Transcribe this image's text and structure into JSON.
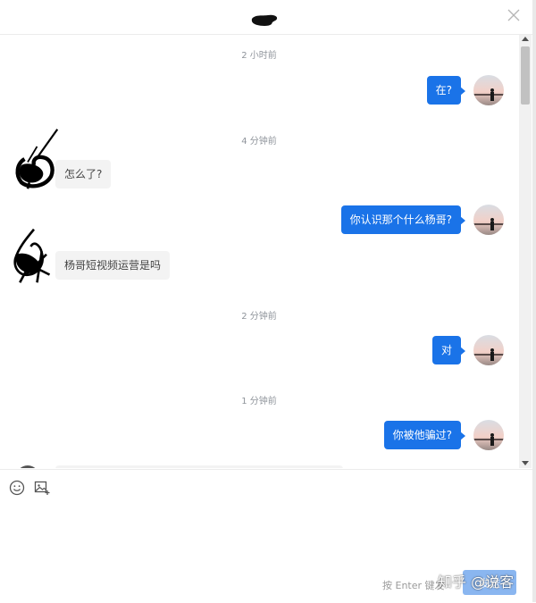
{
  "header": {
    "close_icon": "close-icon"
  },
  "messages": [
    {
      "kind": "time",
      "text": "2 小时前"
    },
    {
      "kind": "out",
      "text": "在?"
    },
    {
      "kind": "time",
      "text": "4 分钟前"
    },
    {
      "kind": "in",
      "text": "怎么了?"
    },
    {
      "kind": "out",
      "text": "你认识那个什么杨哥?"
    },
    {
      "kind": "in",
      "text": "杨哥短视频运营是吗"
    },
    {
      "kind": "time",
      "text": "2 分钟前"
    },
    {
      "kind": "out",
      "text": "对"
    },
    {
      "kind": "time",
      "text": "1 分钟前"
    },
    {
      "kind": "out",
      "text": "你被他骗过?"
    }
  ],
  "composer": {
    "emoji_icon": "emoji-icon",
    "image_icon": "image-upload-icon",
    "hint": "按 Enter 键发",
    "send_label": "发送"
  },
  "watermark": "知乎 @说客",
  "colors": {
    "outgoing_bubble": "#1a73e8",
    "incoming_bubble": "#f3f3f3",
    "send_button": "#8ab6f0"
  }
}
